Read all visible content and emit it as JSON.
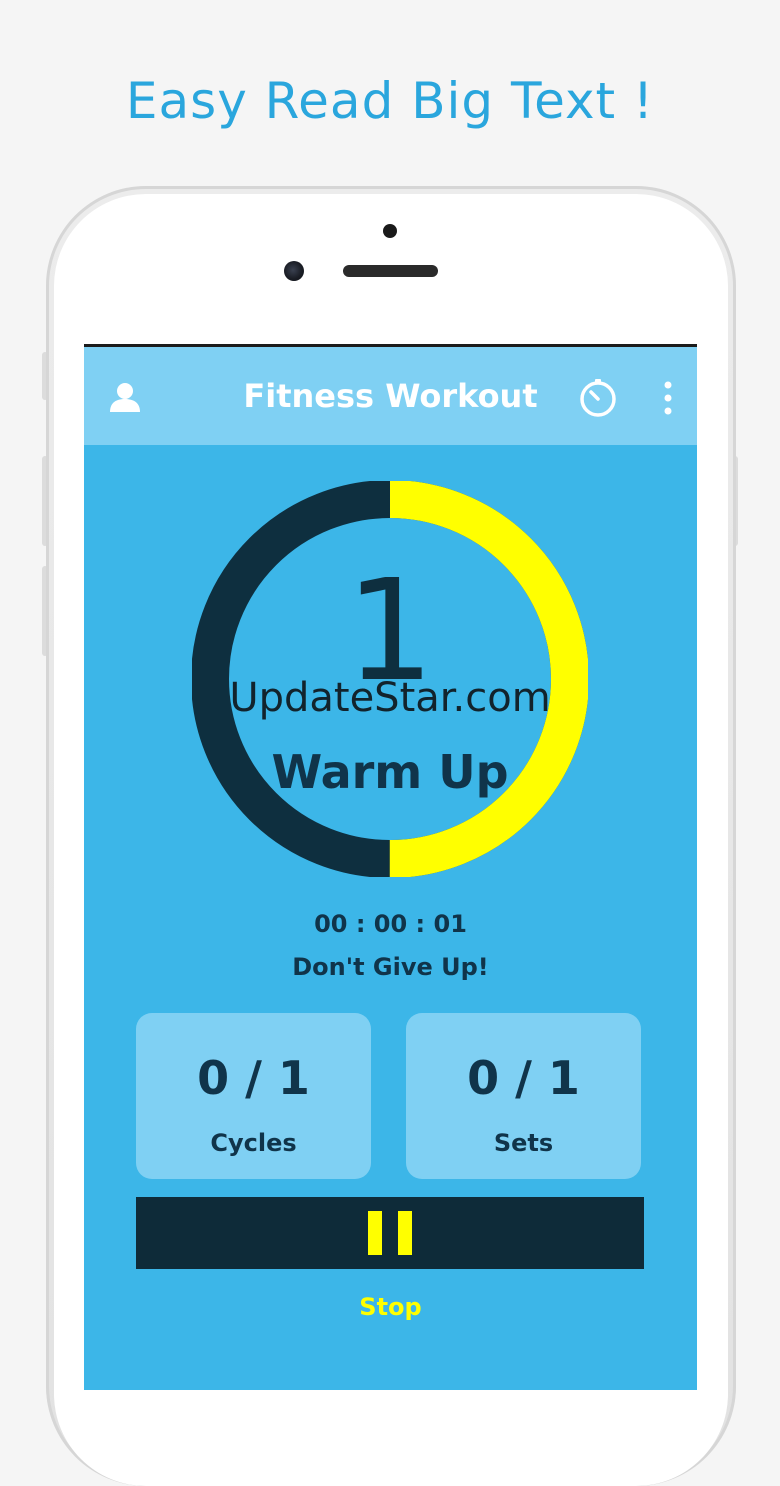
{
  "promo": {
    "headline": "Easy Read Big Text !"
  },
  "appbar": {
    "title": "Fitness Workout",
    "icons": [
      "user-icon",
      "timer-icon",
      "more-vertical-icon"
    ]
  },
  "timer_ring": {
    "count": "1",
    "phase": "Warm Up",
    "progress_fraction": 0.5,
    "colors": {
      "progress": "#ffff00",
      "remaining": "#0e2f3f"
    }
  },
  "watermark": "UpdateStar.com",
  "status": {
    "elapsed": "00 : 00 : 01",
    "motto": "Don't Give Up!"
  },
  "stats": {
    "cycles": {
      "value": "0 / 1",
      "label": "Cycles"
    },
    "sets": {
      "value": "0 / 1",
      "label": "Sets"
    }
  },
  "controls": {
    "pause_icon": "pause-icon",
    "stop_label": "Stop"
  },
  "colors": {
    "screen_bg": "#3cb6e8",
    "appbar_bg": "#7fd0f3",
    "accent": "#ffff00",
    "dark": "#0e2b39",
    "headline": "#2aa6dd"
  }
}
